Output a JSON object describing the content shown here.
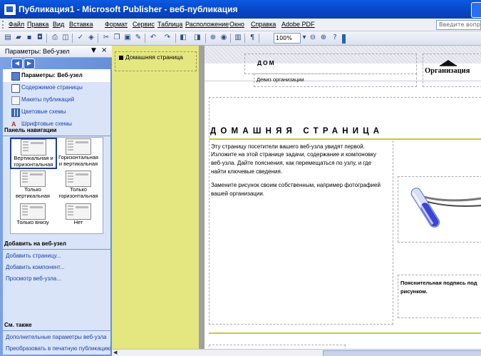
{
  "window": {
    "title": "Публикация1 - Microsoft Publisher - веб-публикация"
  },
  "menu": {
    "items": [
      "Файл",
      "Правка",
      "Вид",
      "Вставка",
      "Формат",
      "Сервис",
      "Таблица",
      "Расположение",
      "Окно",
      "Справка",
      "Adobe PDF"
    ],
    "help_placeholder": "Введите вопрос"
  },
  "toolbar": {
    "zoom": "100%"
  },
  "task_pane": {
    "title": "Параметры: Веб-узел",
    "items": [
      {
        "label": "Параметры: Веб-узел",
        "icon": "web-options-icon"
      },
      {
        "label": "Содержимое страницы",
        "icon": "page-content-icon"
      },
      {
        "label": "Макеты публикаций",
        "icon": "layouts-icon"
      },
      {
        "label": "Цветовые схемы",
        "icon": "color-schemes-icon"
      },
      {
        "label": "Шрифтовые схемы",
        "icon": "font-schemes-icon"
      }
    ],
    "nav_section": "Панель навигации",
    "nav_options": [
      "Вертикальная и горизонтальная",
      "Горизонтальная и вертикальная",
      "Только вертикальная",
      "Только горизонтальная",
      "Только внизу",
      "Нет"
    ],
    "add_section": "Добавить на веб-узел",
    "add_links": [
      "Добавить страницу...",
      "Добавить компонент...",
      "Просмотр веб-узла..."
    ],
    "see_also_section": "См. также",
    "see_also_links": [
      "Дополнительные параметры веб-узла",
      "Преобразовать в печатную публикацию"
    ]
  },
  "page_strip": {
    "page_button": "Домашняя страница"
  },
  "page": {
    "nav_home": "ДОМ",
    "motto": "Девиз организации",
    "org_name": "Организация",
    "heading": "ДОМАШНЯЯ СТРАНИЦА",
    "para1": [
      "Эту страницу посетители вашего веб-узла увидят первой.",
      "Изложите на этой странице задачи, содержание и компоновку",
      "веб-узла. Дайте пояснения, как перемещаться по узлу, и где",
      "найти ключевые сведения."
    ],
    "para2": [
      "Замените рисунок своим собственным, например фотографией",
      "вашей организации."
    ],
    "caption": [
      "Пояснительная подпись под",
      "рисунком."
    ]
  },
  "colors": {
    "accent_yellow": "#c6c73e",
    "pane_blue": "#6790d8",
    "title_blue": "#0845c6"
  }
}
